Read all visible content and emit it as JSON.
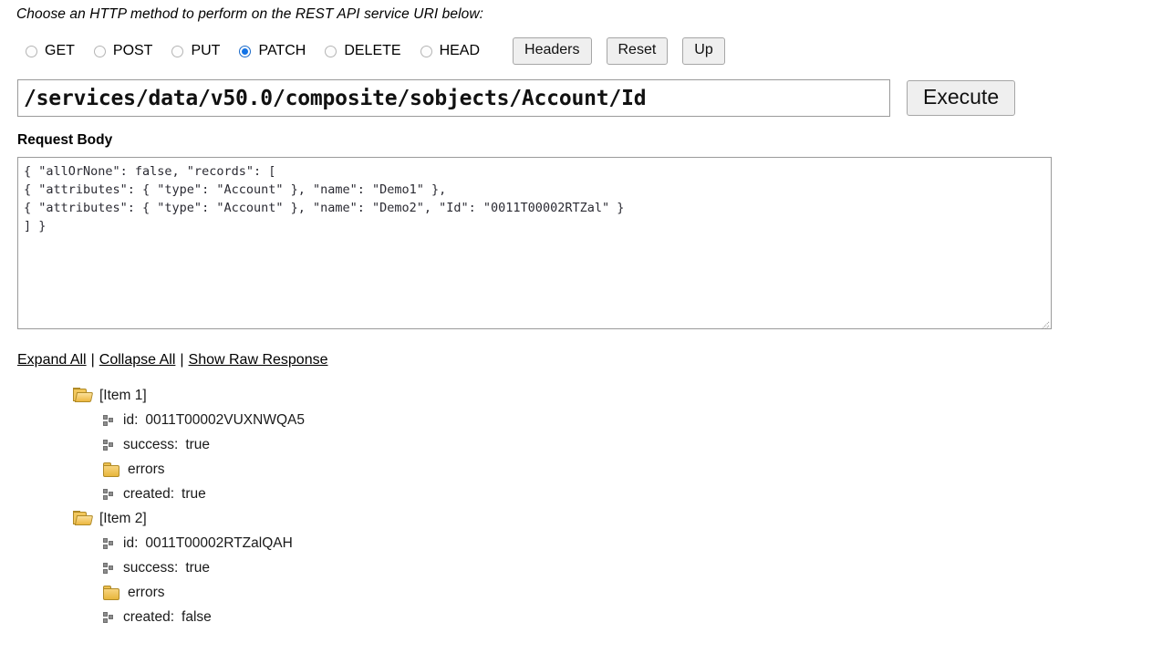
{
  "instruction": "Choose an HTTP method to perform on the REST API service URI below:",
  "methods": [
    {
      "label": "GET",
      "checked": false
    },
    {
      "label": "POST",
      "checked": false
    },
    {
      "label": "PUT",
      "checked": false
    },
    {
      "label": "PATCH",
      "checked": true
    },
    {
      "label": "DELETE",
      "checked": false
    },
    {
      "label": "HEAD",
      "checked": false
    }
  ],
  "buttons": {
    "headers": "Headers",
    "reset": "Reset",
    "up": "Up",
    "execute": "Execute"
  },
  "uri": {
    "value": "/services/data/v50.0/composite/sobjects/Account/Id",
    "placeholder": "/services/data/"
  },
  "request_body": {
    "label": "Request Body",
    "value": "{ \"allOrNone\": false, \"records\": [\n{ \"attributes\": { \"type\": \"Account\" }, \"name\": \"Demo1\" },\n{ \"attributes\": { \"type\": \"Account\" }, \"name\": \"Demo2\", \"Id\": \"0011T00002RTZal\" }\n] }"
  },
  "response_links": {
    "expand_all": "Expand All",
    "collapse_all": "Collapse All",
    "show_raw": "Show Raw Response",
    "separator": "|"
  },
  "response_tree": [
    {
      "icon": "folder-open-icon",
      "label": "[Item 1]",
      "children": [
        {
          "icon": "leaf-icon",
          "key": "id:",
          "value": "0011T00002VUXNWQA5"
        },
        {
          "icon": "leaf-icon",
          "key": "success:",
          "value": "true"
        },
        {
          "icon": "folder-closed-icon",
          "key": "errors",
          "value": ""
        },
        {
          "icon": "leaf-icon",
          "key": "created:",
          "value": "true"
        }
      ]
    },
    {
      "icon": "folder-open-icon",
      "label": "[Item 2]",
      "children": [
        {
          "icon": "leaf-icon",
          "key": "id:",
          "value": "0011T00002RTZalQAH"
        },
        {
          "icon": "leaf-icon",
          "key": "success:",
          "value": "true"
        },
        {
          "icon": "folder-closed-icon",
          "key": "errors",
          "value": ""
        },
        {
          "icon": "leaf-icon",
          "key": "created:",
          "value": "false"
        }
      ]
    }
  ],
  "colors": {
    "accent": "#1273e6",
    "folder": "#edc050",
    "button_bg": "#efefef",
    "border": "#9a9a9a"
  }
}
